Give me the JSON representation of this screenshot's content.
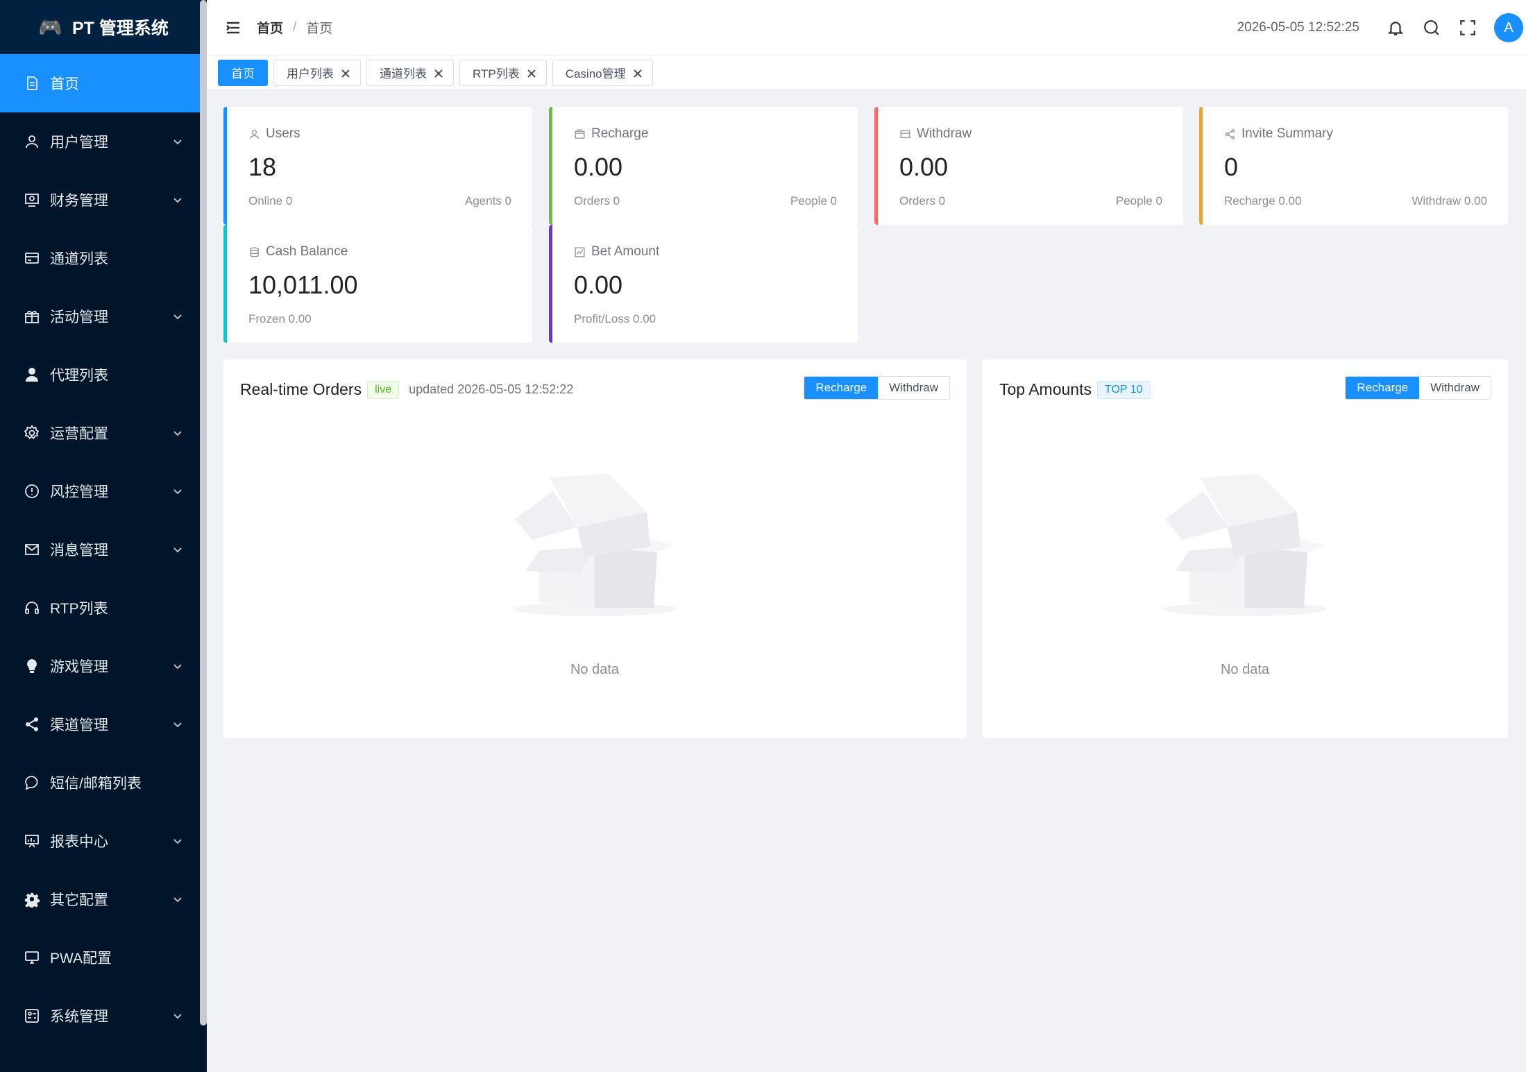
{
  "brand": {
    "title": "PT 管理系统",
    "logo_icon": "gamepad-icon"
  },
  "sidebar": {
    "items": [
      {
        "label": "首页",
        "icon": "document-icon",
        "active": true,
        "expandable": false
      },
      {
        "label": "用户管理",
        "icon": "user-icon",
        "expandable": true
      },
      {
        "label": "财务管理",
        "icon": "finance-icon",
        "expandable": true
      },
      {
        "label": "通道列表",
        "icon": "card-icon",
        "expandable": false
      },
      {
        "label": "活动管理",
        "icon": "gift-icon",
        "expandable": true
      },
      {
        "label": "代理列表",
        "icon": "user-solid-icon",
        "expandable": false
      },
      {
        "label": "运营配置",
        "icon": "gear-icon",
        "expandable": true
      },
      {
        "label": "风控管理",
        "icon": "warning-circle-icon",
        "expandable": true
      },
      {
        "label": "消息管理",
        "icon": "mail-icon",
        "expandable": true
      },
      {
        "label": "RTP列表",
        "icon": "headset-icon",
        "expandable": false
      },
      {
        "label": "游戏管理",
        "icon": "bulb-icon",
        "expandable": true
      },
      {
        "label": "渠道管理",
        "icon": "share-icon",
        "expandable": true
      },
      {
        "label": "短信/邮箱列表",
        "icon": "chat-icon",
        "expandable": false
      },
      {
        "label": "报表中心",
        "icon": "chart-board-icon",
        "expandable": true
      },
      {
        "label": "其它配置",
        "icon": "cog-solid-icon",
        "expandable": true
      },
      {
        "label": "PWA配置",
        "icon": "monitor-icon",
        "expandable": false
      },
      {
        "label": "系统管理",
        "icon": "system-icon",
        "expandable": true
      }
    ]
  },
  "header": {
    "breadcrumb": [
      "首页",
      "首页"
    ],
    "separator": "/",
    "clock": "2026-05-05 12:52:25",
    "avatar_letter": "A"
  },
  "tabs": [
    {
      "label": "首页",
      "active": true
    },
    {
      "label": "用户列表",
      "active": false
    },
    {
      "label": "通道列表",
      "active": false
    },
    {
      "label": "RTP列表",
      "active": false
    },
    {
      "label": "Casino管理",
      "active": false
    }
  ],
  "stats": {
    "users": {
      "label": "Users",
      "value": "18",
      "sub_left": "Online 0",
      "sub_right": "Agents 0",
      "color": "#1890ff"
    },
    "recharge": {
      "label": "Recharge",
      "value": "0.00",
      "sub_left": "Orders 0",
      "sub_right": "People 0",
      "color": "#67c23a"
    },
    "withdraw": {
      "label": "Withdraw",
      "value": "0.00",
      "sub_left": "Orders 0",
      "sub_right": "People 0",
      "color": "#f56c6c"
    },
    "invite": {
      "label": "Invite Summary",
      "value": "0",
      "sub_left": "Recharge 0.00",
      "sub_right": "Withdraw 0.00",
      "color": "#e6a23c"
    },
    "cash": {
      "label": "Cash Balance",
      "value": "10,011.00",
      "sub_left": "Frozen 0.00",
      "color": "#13c2c2"
    },
    "bet": {
      "label": "Bet Amount",
      "value": "0.00",
      "sub_left": "Profit/Loss 0.00",
      "color": "#722ed1"
    }
  },
  "orders_panel": {
    "title": "Real-time Orders",
    "tag": "live",
    "updated": "updated 2026-05-05 12:52:22",
    "seg": [
      "Recharge",
      "Withdraw"
    ],
    "empty": "No data"
  },
  "top_panel": {
    "title": "Top Amounts",
    "tag": "TOP 10",
    "seg": [
      "Recharge",
      "Withdraw"
    ],
    "empty": "No data"
  }
}
